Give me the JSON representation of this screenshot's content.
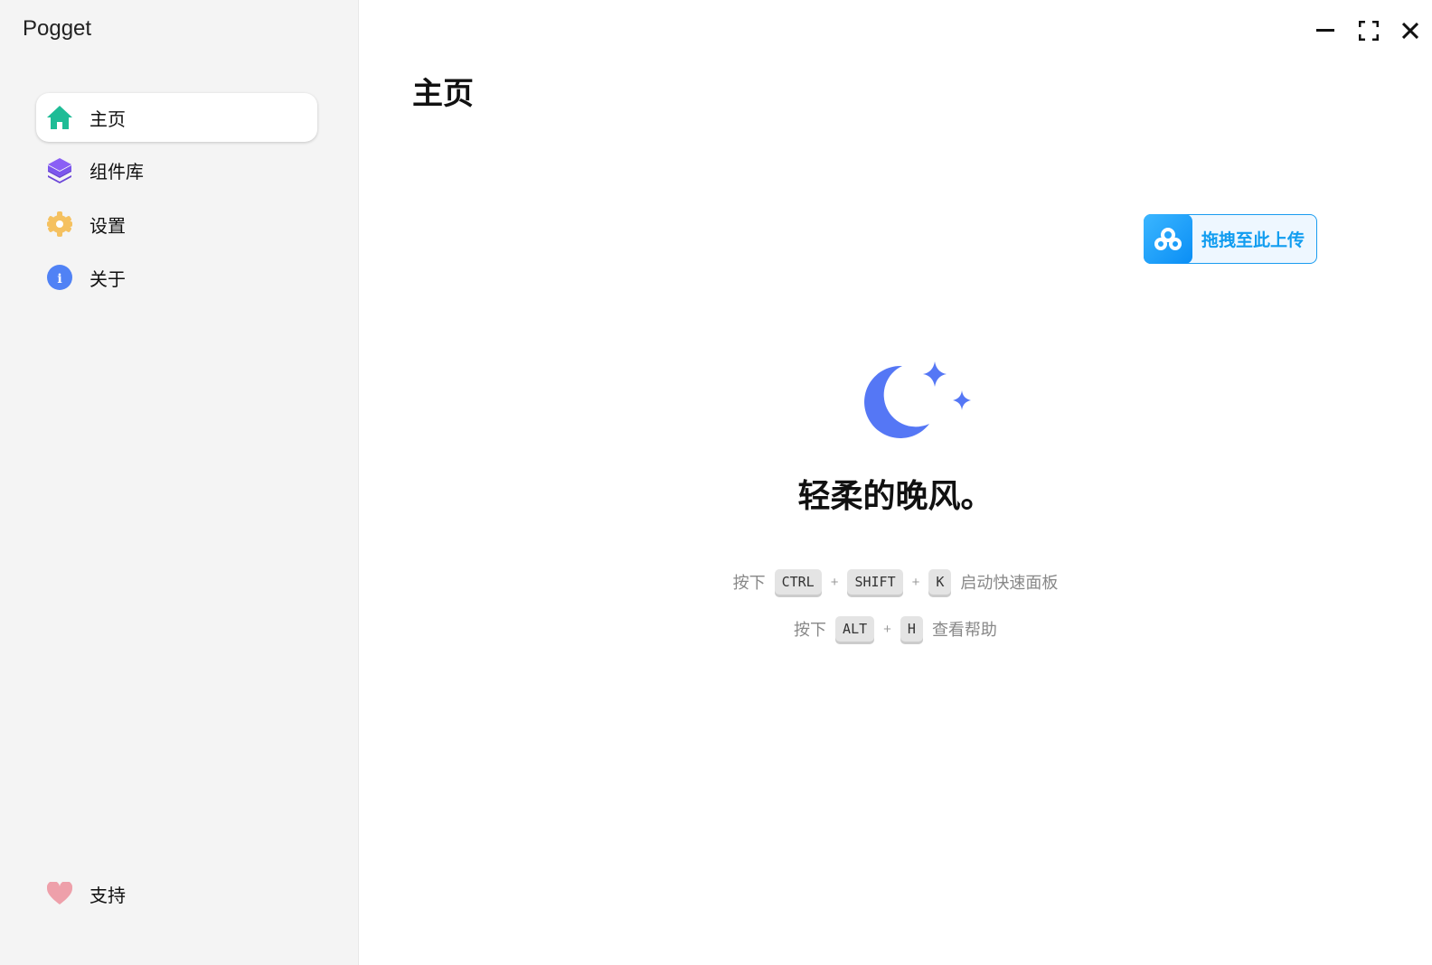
{
  "app": {
    "title": "Pogget"
  },
  "sidebar": {
    "items": [
      {
        "label": "主页",
        "icon": "home-icon",
        "color": "#1ebc96",
        "active": true
      },
      {
        "label": "组件库",
        "icon": "layers-icon",
        "color": "#7c55ee"
      },
      {
        "label": "设置",
        "icon": "gear-icon",
        "color": "#f5c160"
      },
      {
        "label": "关于",
        "icon": "info-icon",
        "color": "#5082f5"
      }
    ],
    "support": {
      "label": "支持",
      "icon": "heart-icon",
      "color": "#eea0aa"
    }
  },
  "main": {
    "title": "主页",
    "upload_label": "拖拽至此上传",
    "slogan": "轻柔的晚风。",
    "hints": [
      {
        "prefix": "按下",
        "keys": [
          "CTRL",
          "SHIFT",
          "K"
        ],
        "suffix": "启动快速面板"
      },
      {
        "prefix": "按下",
        "keys": [
          "ALT",
          "H"
        ],
        "suffix": "查看帮助"
      }
    ],
    "plus": "+"
  },
  "window": {
    "minimize": "—",
    "maximize": "⛶",
    "close": "✕"
  }
}
